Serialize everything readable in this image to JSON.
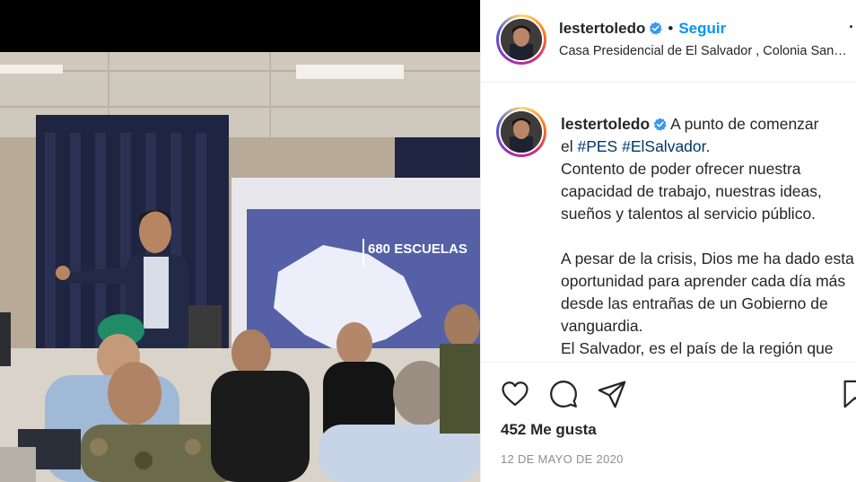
{
  "post": {
    "username": "lestertoledo",
    "follow_label": "Seguir",
    "separator": "•",
    "location": "Casa Presidencial de El Salvador , Colonia San…",
    "more": "·",
    "caption": {
      "line1_text": "A punto de comenzar",
      "line2_prefix": "el ",
      "hashtag1": "#PES",
      "hashtag2": "#ElSalvador",
      "line2_suffix": ".",
      "paragraph1": "Contento de poder ofrecer nuestra capacidad de trabajo, nuestras ideas, sueños y talentos al servicio público.",
      "paragraph2": "A pesar de la crisis, Dios me ha dado esta oportunidad para aprender cada día más desde las entrañas de un Gobierno de vanguardia.",
      "paragraph3": "El Salvador, es el país de la región que"
    },
    "likes": "452 Me gusta",
    "date": "12 DE MAYO DE 2020"
  },
  "photo": {
    "screen_text": "680 ESCUELAS"
  },
  "colors": {
    "follow": "#0095f6",
    "hashtag": "#00376b",
    "verified": "#3897f0",
    "muted": "#8e8e8e"
  },
  "icons": [
    "verified-badge-icon",
    "heart-icon",
    "comment-icon",
    "share-icon",
    "bookmark-icon"
  ]
}
